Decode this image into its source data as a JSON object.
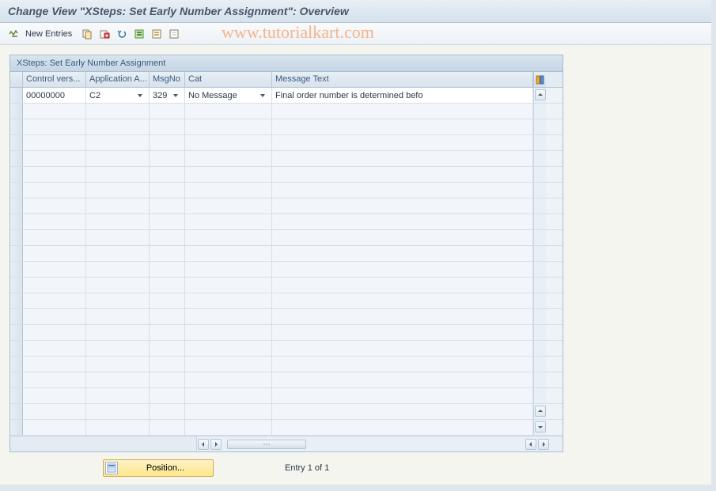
{
  "title": "Change View \"XSteps: Set Early Number Assignment\": Overview",
  "toolbar": {
    "new_entries_label": "New Entries"
  },
  "watermark": "www.tutorialkart.com",
  "panel": {
    "header": "XSteps: Set Early Number Assignment",
    "columns": {
      "control_version": "Control vers...",
      "application_area": "Application A...",
      "msgno": "MsgNo",
      "cat": "Cat",
      "message_text": "Message Text"
    },
    "rows": [
      {
        "control_version": "00000000",
        "application_area": "C2",
        "msgno": "329",
        "cat": "No Message",
        "message_text": "Final order number is determined befo"
      }
    ],
    "empty_row_count": 21
  },
  "footer": {
    "position_label": "Position...",
    "entry_text": "Entry 1 of 1"
  }
}
